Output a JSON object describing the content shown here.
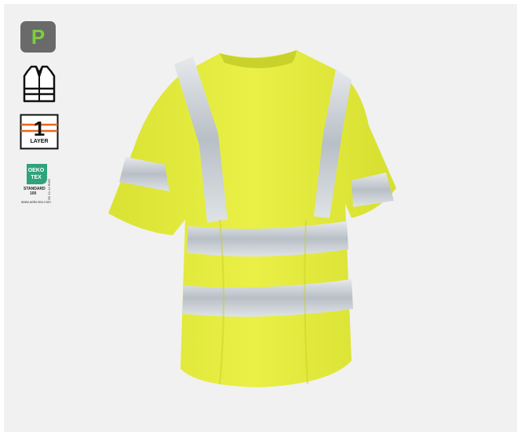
{
  "badges": {
    "pro_label": "P",
    "pro_color": "#7ad23c",
    "vest_icon": "hi-vis-vest-icon",
    "layer_number": "1",
    "layer_label": "LAYER",
    "oeko_brand": "OEKO",
    "oeko_tex": "TEX",
    "oeko_standard": "STANDARD",
    "oeko_standard_number": "100",
    "oeko_side_code": "SE 12-14 RISE",
    "oeko_url": "www.oeko-tex.com"
  },
  "product": {
    "name_icon": "hi-vis-yellow-t-shirt",
    "shirt_color": "#e3ec3f",
    "reflective_color": "#c8ced4"
  }
}
